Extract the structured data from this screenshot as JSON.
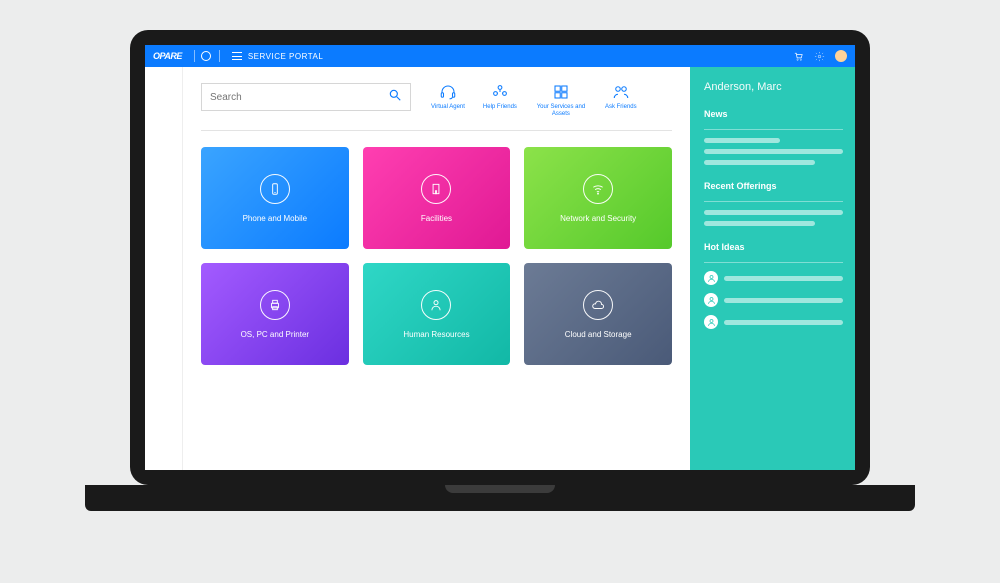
{
  "topbar": {
    "brand": "OPARE",
    "title": "SERVICE PORTAL"
  },
  "search": {
    "placeholder": "Search"
  },
  "quicklinks": [
    {
      "icon": "headset-icon",
      "label": "Virtual Agent"
    },
    {
      "icon": "people-icon",
      "label": "Help Friends"
    },
    {
      "icon": "grid-icon",
      "label": "Your Services and Assets"
    },
    {
      "icon": "pair-icon",
      "label": "Ask Friends"
    }
  ],
  "tiles": [
    {
      "class": "t-blue",
      "icon": "phone-icon",
      "label": "Phone and Mobile"
    },
    {
      "class": "t-pink",
      "icon": "building-icon",
      "label": "Facilities"
    },
    {
      "class": "t-green",
      "icon": "wifi-icon",
      "label": "Network and Security"
    },
    {
      "class": "t-purple",
      "icon": "printer-icon",
      "label": "OS, PC and Printer"
    },
    {
      "class": "t-teal",
      "icon": "person-icon",
      "label": "Human Resources"
    },
    {
      "class": "t-slate",
      "icon": "cloud-icon",
      "label": "Cloud and Storage"
    }
  ],
  "sidebar": {
    "user_name": "Anderson, Marc",
    "sections": {
      "news": "News",
      "recent": "Recent Offerings",
      "ideas": "Hot Ideas"
    }
  }
}
